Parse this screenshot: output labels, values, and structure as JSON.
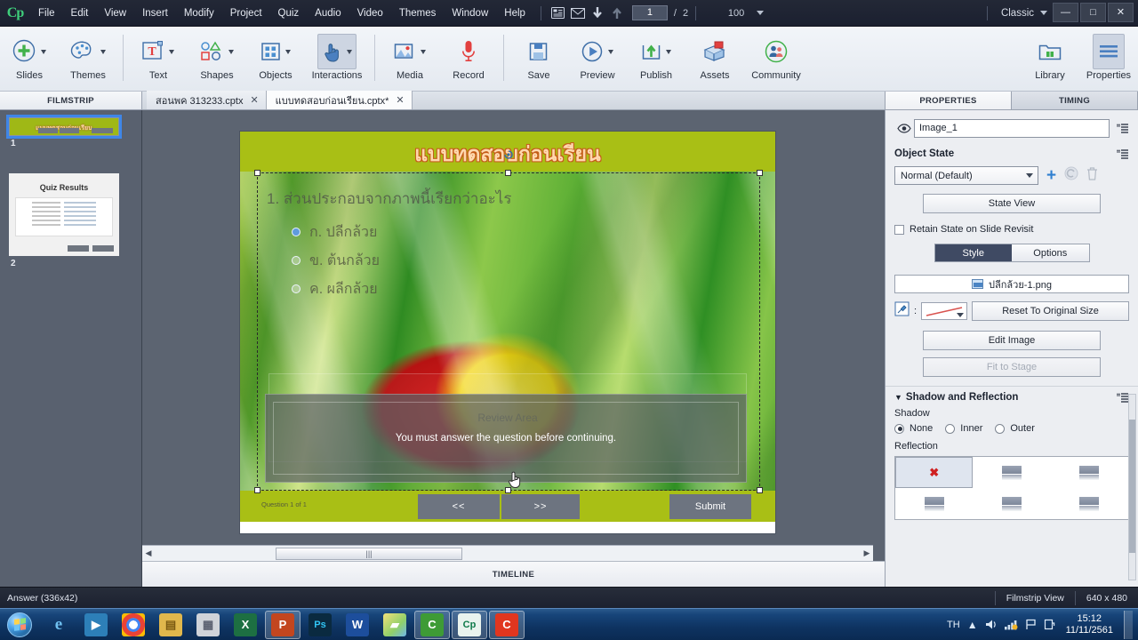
{
  "app": {
    "logo": "Cp",
    "menu": [
      "File",
      "Edit",
      "View",
      "Insert",
      "Modify",
      "Project",
      "Quiz",
      "Audio",
      "Video",
      "Themes",
      "Window",
      "Help"
    ],
    "workspace": "Classic",
    "page_current": "1",
    "page_total": "2",
    "zoom": "100",
    "titlebar_icons": [
      "branching-view-icon",
      "email-icon",
      "download-icon",
      "upload-icon"
    ],
    "window_controls": {
      "minimize": "—",
      "maximize": "□",
      "close": "✕"
    }
  },
  "ribbon": {
    "groups": [
      {
        "items": [
          {
            "label": "Slides",
            "icon": "add-slide-icon",
            "dropdown": true
          },
          {
            "label": "Themes",
            "icon": "palette-icon",
            "dropdown": true
          }
        ]
      },
      {
        "items": [
          {
            "label": "Text",
            "icon": "text-icon",
            "dropdown": true
          },
          {
            "label": "Shapes",
            "icon": "shapes-icon",
            "dropdown": true
          },
          {
            "label": "Objects",
            "icon": "objects-grid-icon",
            "dropdown": true
          },
          {
            "label": "Interactions",
            "icon": "hand-pointer-icon",
            "dropdown": true
          }
        ]
      },
      {
        "items": [
          {
            "label": "Media",
            "icon": "media-image-icon",
            "dropdown": true
          },
          {
            "label": "Record",
            "icon": "microphone-icon",
            "dropdown": false
          }
        ]
      },
      {
        "items": [
          {
            "label": "Save",
            "icon": "floppy-save-icon",
            "dropdown": false
          },
          {
            "label": "Preview",
            "icon": "play-preview-icon",
            "dropdown": true
          },
          {
            "label": "Publish",
            "icon": "publish-upload-icon",
            "dropdown": true
          },
          {
            "label": "Assets",
            "icon": "assets-box-icon",
            "dropdown": false
          },
          {
            "label": "Community",
            "icon": "community-people-icon",
            "dropdown": false
          }
        ]
      }
    ],
    "right": [
      {
        "label": "Library",
        "icon": "library-folder-icon",
        "active": false
      },
      {
        "label": "Properties",
        "icon": "properties-lines-icon",
        "active": true
      }
    ]
  },
  "filmstrip": {
    "header": "FILMSTRIP",
    "slides": [
      {
        "number": "1",
        "selected": true,
        "title": "แบบทดสอบก่อนเรียน"
      },
      {
        "number": "2",
        "selected": false,
        "title": "Quiz Results"
      }
    ]
  },
  "document_tabs": [
    {
      "label": "สอนพค 313233.cptx",
      "active": false,
      "close": "✕"
    },
    {
      "label": "แบบทดสอบก่อนเรียน.cptx*",
      "active": true,
      "close": "✕"
    }
  ],
  "slide": {
    "title": "แบบทดสอบก่อนเรียน",
    "question": "1.  ส่วนประกอบจากภาพนี้เรียกว่าอะไร",
    "choices": [
      {
        "text": "ก.   ปลีกล้วย",
        "selected": true
      },
      {
        "text": "ข.   ต้นกล้วย",
        "selected": false
      },
      {
        "text": "ค.   ผลีกล้วย",
        "selected": false
      }
    ],
    "review_area_label": "Review Area",
    "feedback_message": "You must answer the question before continuing.",
    "question_counter": "Question 1 of 1",
    "buttons": {
      "prev": "<<",
      "next": ">>",
      "submit": "Submit"
    }
  },
  "canvas": {
    "hscroll_grip": "|||",
    "timeline_label": "TIMELINE"
  },
  "properties": {
    "tabs": [
      {
        "label": "PROPERTIES",
        "active": true
      },
      {
        "label": "TIMING",
        "active": false
      }
    ],
    "object_name": "Image_1",
    "object_state_label": "Object State",
    "state_value": "Normal (Default)",
    "state_view_button": "State View",
    "retain_state_label": "Retain State on Slide Revisit",
    "retain_state_checked": false,
    "style_tab": "Style",
    "options_tab": "Options",
    "image_file": "ปลีกล้วย-1.png",
    "reset_size_button": "Reset To Original Size",
    "edit_image_button": "Edit Image",
    "fit_to_stage_button": "Fit to Stage",
    "fit_to_stage_disabled": true,
    "shadow_reflection_section": "Shadow and Reflection",
    "shadow_label": "Shadow",
    "shadow_options": [
      {
        "label": "None",
        "selected": true
      },
      {
        "label": "Inner",
        "selected": false
      },
      {
        "label": "Outer",
        "selected": false
      }
    ],
    "reflection_label": "Reflection",
    "reflection_none_marker": "✖"
  },
  "statusbar": {
    "selection": "Answer (336x42)",
    "view_mode": "Filmstrip View",
    "stage_size": "640 x 480"
  },
  "taskbar": {
    "items": [
      {
        "name": "internet-explorer",
        "glyph": "e",
        "color": "#1b6fb5",
        "open": false
      },
      {
        "name": "media-player",
        "glyph": "▶",
        "color": "#2d7fb8",
        "open": false
      },
      {
        "name": "google-chrome",
        "glyph": "◉",
        "color": "#e8e8e8",
        "open": false
      },
      {
        "name": "file-explorer",
        "glyph": "🗀",
        "color": "#e8b84b",
        "open": false
      },
      {
        "name": "calculator",
        "glyph": "▦",
        "color": "#c9ccd2",
        "open": false
      },
      {
        "name": "excel",
        "glyph": "X",
        "color": "#1d6f42",
        "open": false
      },
      {
        "name": "powerpoint",
        "glyph": "P",
        "color": "#c3461f",
        "open": true
      },
      {
        "name": "photoshop",
        "glyph": "Ps",
        "color": "#0a2a40",
        "open": false
      },
      {
        "name": "word",
        "glyph": "W",
        "color": "#1d4e9c",
        "open": false
      },
      {
        "name": "folder-yellow",
        "glyph": "▰",
        "color": "#e2c45a",
        "open": false
      },
      {
        "name": "camtasia",
        "glyph": "C",
        "color": "#3e9b36",
        "open": true
      },
      {
        "name": "captivate",
        "glyph": "Cp",
        "color": "#0f7a4a",
        "open": true
      },
      {
        "name": "camtasia-studio",
        "glyph": "C",
        "color": "#e1361f",
        "open": true
      }
    ],
    "tray": {
      "language": "TH",
      "icons": [
        "show-hidden-icon",
        "volume-icon",
        "network-icon",
        "flag-action-center-icon",
        "battery-icon"
      ],
      "time": "15:12",
      "date": "11/11/2561"
    }
  }
}
